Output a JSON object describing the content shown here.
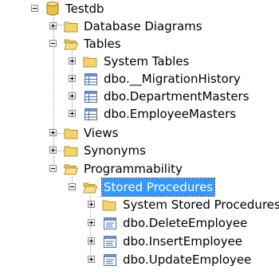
{
  "tree": {
    "database": {
      "label": "Testdb",
      "icon": "database-icon"
    },
    "database_diagrams": {
      "label": "Database Diagrams",
      "icon": "folder-icon"
    },
    "tables": {
      "label": "Tables",
      "icon": "folder-open-icon",
      "children": [
        {
          "label": "System Tables",
          "icon": "folder-icon"
        },
        {
          "label": "dbo.__MigrationHistory",
          "icon": "table-icon"
        },
        {
          "label": "dbo.DepartmentMasters",
          "icon": "table-icon"
        },
        {
          "label": "dbo.EmployeeMasters",
          "icon": "table-icon"
        }
      ]
    },
    "views": {
      "label": "Views",
      "icon": "folder-icon"
    },
    "synonyms": {
      "label": "Synonyms",
      "icon": "folder-icon"
    },
    "programmability": {
      "label": "Programmability",
      "icon": "folder-open-icon"
    },
    "stored_procedures": {
      "label": "Stored Procedures",
      "icon": "folder-open-icon",
      "selected": true,
      "children": [
        {
          "label": "System Stored Procedures",
          "icon": "folder-icon"
        },
        {
          "label": "dbo.DeleteEmployee",
          "icon": "stored-procedure-icon"
        },
        {
          "label": "dbo.InsertEmployee",
          "icon": "stored-procedure-icon"
        },
        {
          "label": "dbo.UpdateEmployee",
          "icon": "stored-procedure-icon"
        }
      ]
    }
  },
  "colors": {
    "selection": "#3399ff",
    "folder": "#f5d46b",
    "database": "#e8c24a"
  }
}
